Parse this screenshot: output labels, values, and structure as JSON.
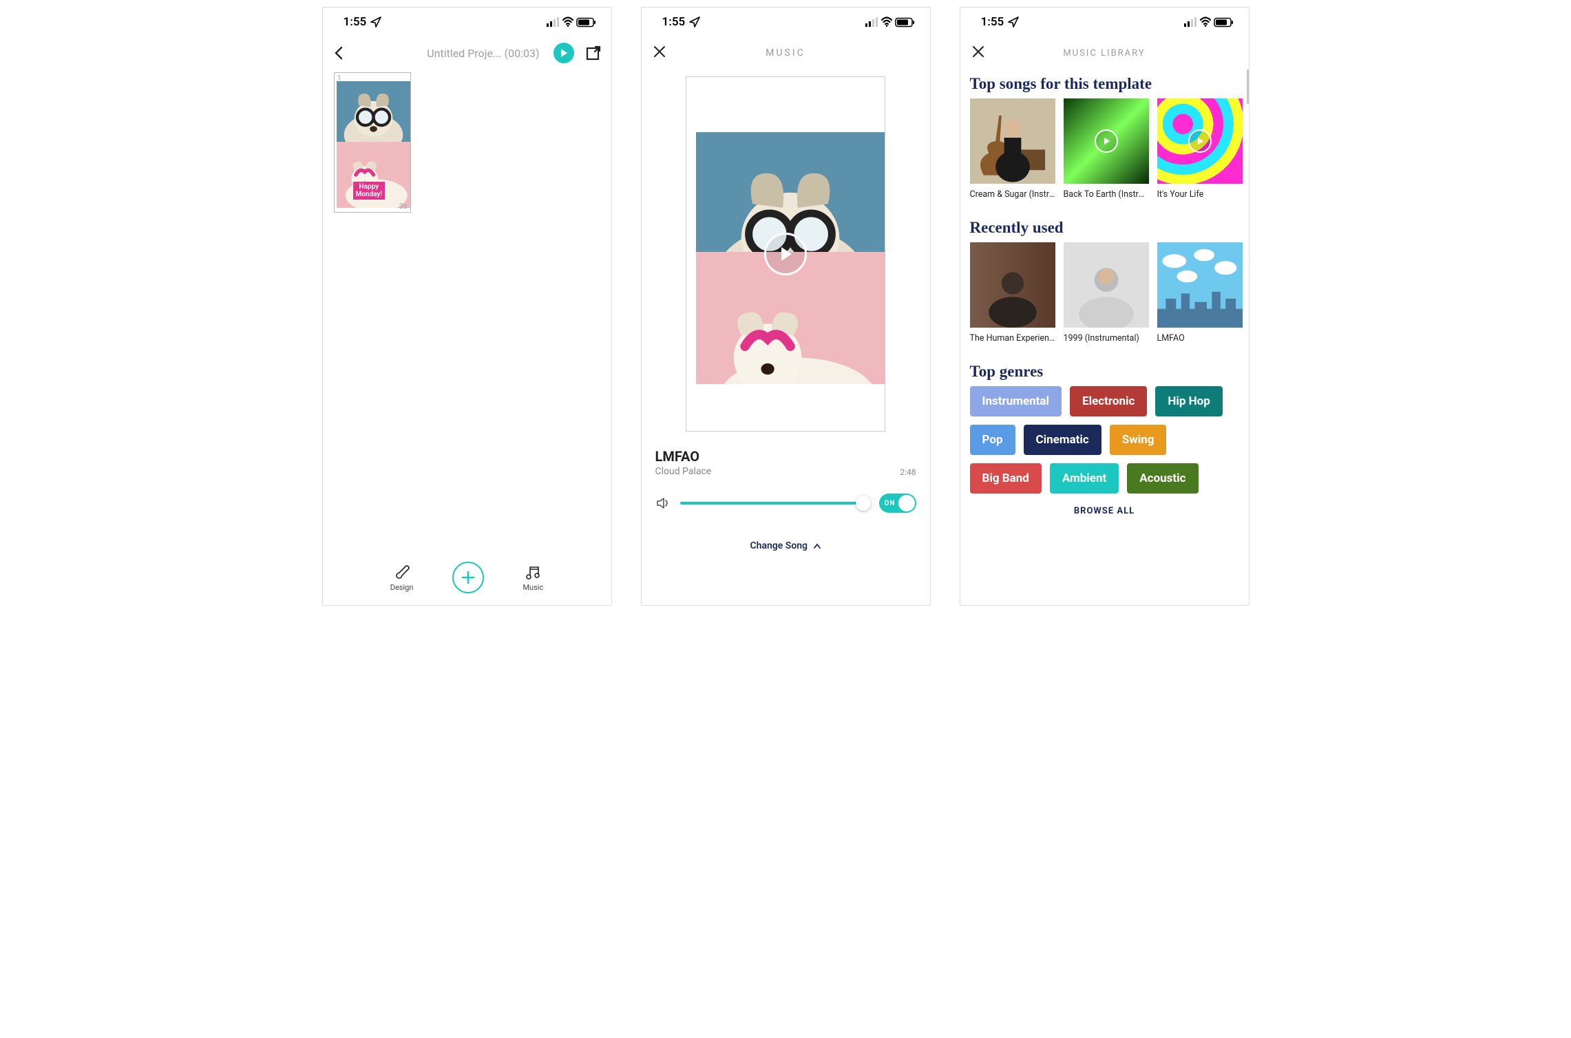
{
  "status": {
    "time": "1:55"
  },
  "screen1": {
    "title": "Untitled Proje... (00:03)",
    "thumb": {
      "slot": "1",
      "duration": "3s",
      "banner_line1": "Happy",
      "banner_line2": "Monday!"
    },
    "bottom": {
      "design": "Design",
      "music": "Music"
    }
  },
  "screen2": {
    "header": "MUSIC",
    "song_title": "LMFAO",
    "song_artist": "Cloud Palace",
    "song_duration": "2:48",
    "toggle_label": "ON",
    "change_song": "Change Song"
  },
  "screen3": {
    "header": "MUSIC LIBRARY",
    "section_top": "Top songs for this template",
    "section_recent": "Recently used",
    "section_genres": "Top genres",
    "browse_all": "BROWSE ALL",
    "top_songs": [
      {
        "title": "Cream & Sugar (Instru...",
        "bg": "linear-gradient(135deg,#b9a07a,#6e5a3d)"
      },
      {
        "title": "Back To Earth (Instru...",
        "bg": "linear-gradient(135deg,#0a3d0a 0%,#7fff5a 50%,#052905 100%)"
      },
      {
        "title": "It's Your Life",
        "bg": "radial-gradient(circle at 30% 30%, #ff2ad1 0 12%, #27e6ff 12% 24%, #f9ff2a 24% 36%, #ff2ad1 36% 48%, #27e6ff 48% 60%, #f9ff2a 60% 72%, #ff2ad1 72% 100%)"
      }
    ],
    "recent": [
      {
        "title": "The Human Experienc...",
        "bg": "linear-gradient(#8a5a4a,#6b4030)"
      },
      {
        "title": "1999 (Instrumental)",
        "bg": "linear-gradient(#d8d8d8,#e8e8e8)"
      },
      {
        "title": "LMFAO",
        "bg": "linear-gradient(#6fc9ef,#9fe0ff)"
      }
    ],
    "genres": [
      {
        "label": "Instrumental",
        "color": "#8da7e6"
      },
      {
        "label": "Electronic",
        "color": "#b43a36"
      },
      {
        "label": "Hip Hop",
        "color": "#0e7d7a"
      },
      {
        "label": "Pop",
        "color": "#5a9be6"
      },
      {
        "label": "Cinematic",
        "color": "#1b2a5b"
      },
      {
        "label": "Swing",
        "color": "#e89a1f"
      },
      {
        "label": "Big Band",
        "color": "#d94a4a"
      },
      {
        "label": "Ambient",
        "color": "#1ec6c0"
      },
      {
        "label": "Acoustic",
        "color": "#4a7a1f"
      }
    ]
  }
}
